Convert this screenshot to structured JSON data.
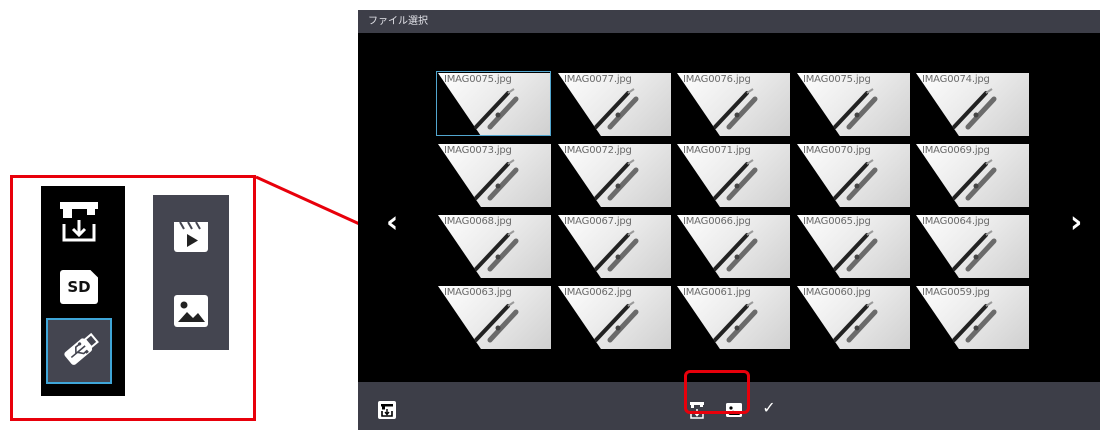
{
  "window": {
    "title": "ファイル選択"
  },
  "callout": {
    "sources": [
      {
        "name": "document-camera",
        "icon": "document-camera-icon"
      },
      {
        "name": "sd-card",
        "icon": "sd-card-icon",
        "label": "SD"
      },
      {
        "name": "usb",
        "icon": "usb-icon",
        "selected": true
      }
    ],
    "types": [
      {
        "name": "video",
        "icon": "video-clapper-icon"
      },
      {
        "name": "image",
        "icon": "image-icon"
      }
    ]
  },
  "navigation": {
    "prev": "‹",
    "next": "›"
  },
  "files": [
    "IMAG0075.jpg",
    "IMAG0077.jpg",
    "IMAG0076.jpg",
    "IMAG0075.jpg",
    "IMAG0074.jpg",
    "IMAG0073.jpg",
    "IMAG0072.jpg",
    "IMAG0071.jpg",
    "IMAG0070.jpg",
    "IMAG0069.jpg",
    "IMAG0068.jpg",
    "IMAG0067.jpg",
    "IMAG0066.jpg",
    "IMAG0065.jpg",
    "IMAG0064.jpg",
    "IMAG0063.jpg",
    "IMAG0062.jpg",
    "IMAG0061.jpg",
    "IMAG0060.jpg",
    "IMAG0059.jpg"
  ],
  "selected_file_index": 0,
  "bottom_bar": {
    "left_icon": "document-camera-icon",
    "source_icon": "document-camera-icon",
    "type_icon": "image-icon",
    "confirm": "✓"
  },
  "colors": {
    "highlight": "#e8000b",
    "selection": "#52a6cf",
    "bar": "#3d3e48",
    "button_bg": "#444550"
  }
}
